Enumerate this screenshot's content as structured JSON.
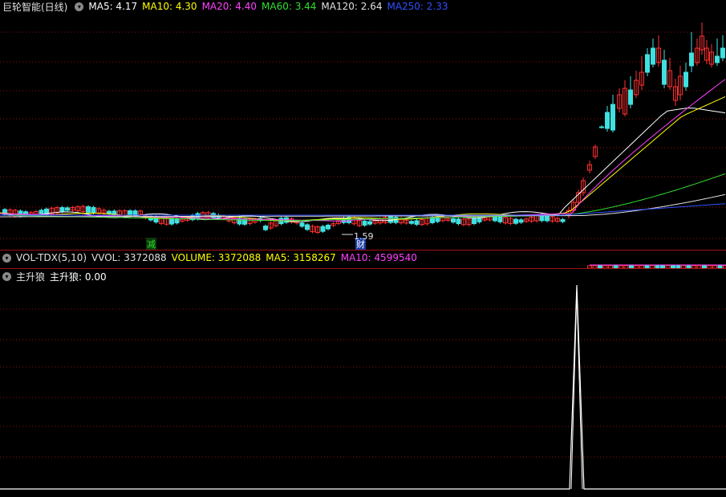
{
  "price_panel": {
    "stock_title": "巨轮智能(日线)",
    "ma_items": [
      {
        "label": "MA5: 4.17",
        "color": "#ffffff"
      },
      {
        "label": "MA10: 4.30",
        "color": "#ffff00"
      },
      {
        "label": "MA20: 4.40",
        "color": "#ff40ff"
      },
      {
        "label": "MA60: 3.44",
        "color": "#30e030"
      },
      {
        "label": "MA120: 2.64",
        "color": "#e0e0e0"
      },
      {
        "label": "MA250: 2.33",
        "color": "#3050ff"
      }
    ],
    "low_price_label": "1.59",
    "marker_reduce": "减",
    "marker_finance": "财"
  },
  "volume_panel": {
    "indicator": "VOL-TDX(5,10)",
    "items": [
      {
        "label": "VVOL: 3372088",
        "color": "#e0e0e0"
      },
      {
        "label": "VOLUME: 3372088",
        "color": "#ffff00"
      },
      {
        "label": "MA5: 3158267",
        "color": "#ffff00"
      },
      {
        "label": "MA10: 4599540",
        "color": "#ff40ff"
      }
    ]
  },
  "signal_panel": {
    "indicator": "主升狼",
    "value_label": "主升狼: 0.00"
  },
  "colors": {
    "up": "#ff3030",
    "down": "#40e0e0",
    "grid": "#8a1010",
    "divider": "#a01010"
  }
}
